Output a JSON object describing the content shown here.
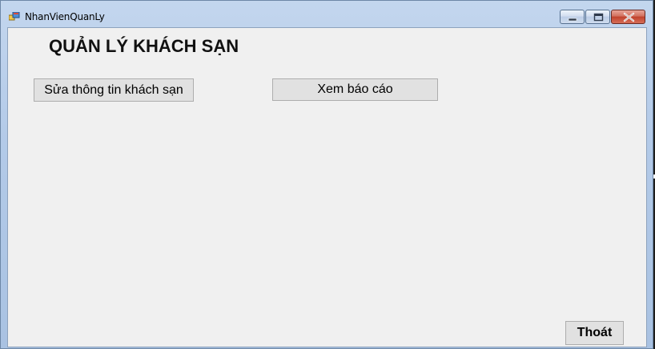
{
  "window": {
    "title": "NhanVienQuanLy",
    "icon": "app-window-icon",
    "caption_buttons": [
      "minimize-icon",
      "maximize-icon",
      "close-icon"
    ]
  },
  "form": {
    "heading": "QUẢN LÝ KHÁCH SẠN",
    "buttons": {
      "edit_hotel": "Sửa thông tin khách sạn",
      "view_report": "Xem báo cáo",
      "exit": "Thoát"
    }
  },
  "colors": {
    "form_background": "#f0f0f0",
    "button_face": "#e1e1e1",
    "button_border": "#adadad",
    "close_button": "#c0412c"
  }
}
